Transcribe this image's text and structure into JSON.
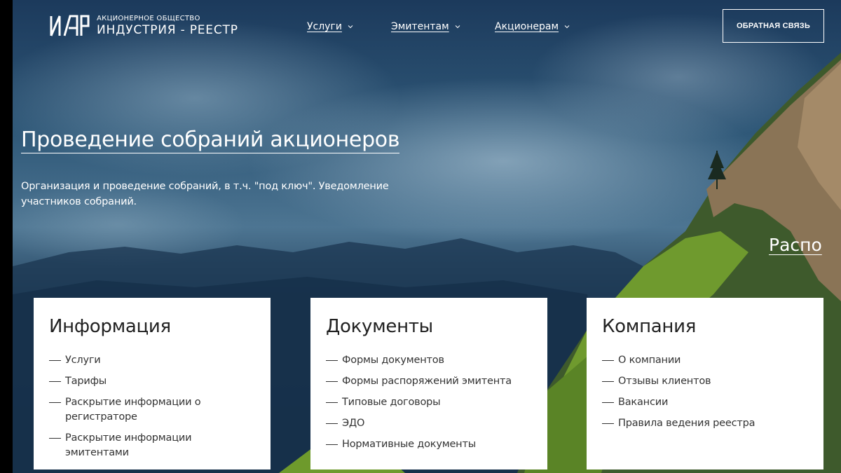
{
  "header": {
    "logo_small": "АКЦИОНЕРНОЕ ОБЩЕСТВО",
    "logo_big": "ИНДУСТРИЯ - РЕЕСТР",
    "nav": [
      {
        "label": "Услуги"
      },
      {
        "label": "Эмитентам"
      },
      {
        "label": "Акционерам"
      }
    ],
    "feedback_label": "ОБРАТНАЯ СВЯЗЬ"
  },
  "hero": {
    "title": "Проведение собраний акционеров",
    "description": "Организация и проведение собраний, в т.ч. \"под ключ\". Уведомление участников собраний.",
    "next_slide_label": "Распо"
  },
  "cards": [
    {
      "title": "Информация",
      "items": [
        "Услуги",
        "Тарифы",
        "Раскрытие информации о регистраторе",
        "Раскрытие информации эмитентами"
      ]
    },
    {
      "title": "Документы",
      "items": [
        "Формы документов",
        "Формы распоряжений эмитента",
        "Типовые договоры",
        "ЭДО",
        "Нормативные документы"
      ]
    },
    {
      "title": "Компания",
      "items": [
        "О компании",
        "Отзывы клиентов",
        "Вакансии",
        "Правила ведения реестра"
      ]
    }
  ]
}
